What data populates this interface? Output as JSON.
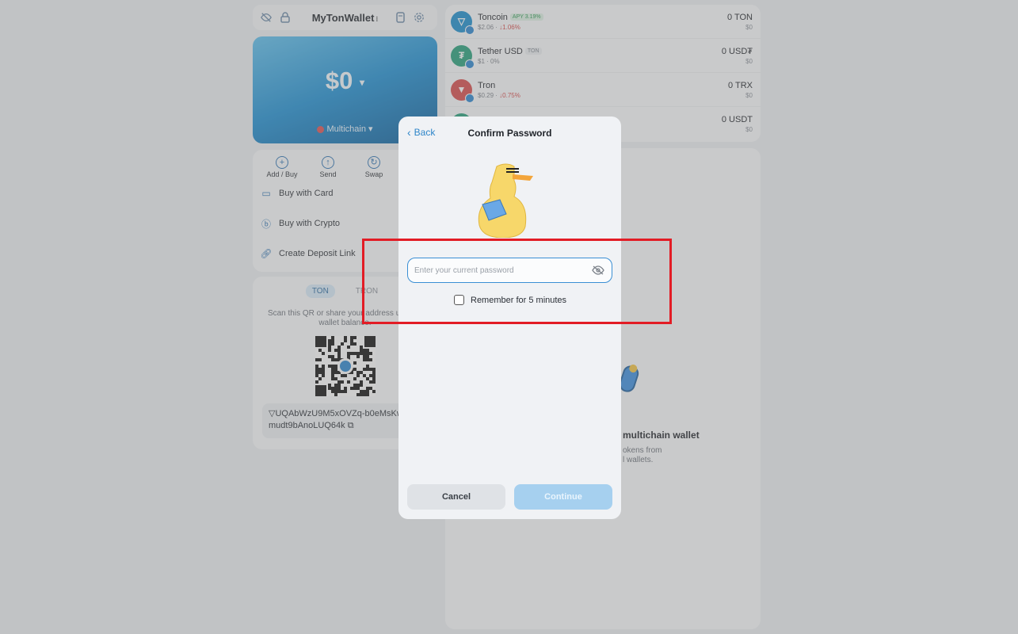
{
  "wallet": {
    "name": "MyTonWallet",
    "balance": "$0",
    "network": "Multichain"
  },
  "actions": [
    {
      "label": "Add / Buy",
      "icon": "plus-circle-icon"
    },
    {
      "label": "Send",
      "icon": "arrow-up-icon"
    },
    {
      "label": "Swap",
      "icon": "swap-icon"
    }
  ],
  "menu": [
    {
      "label": "Buy with Card",
      "icon": "card-icon"
    },
    {
      "label": "Buy with Crypto",
      "icon": "coin-icon"
    },
    {
      "label": "Create Deposit Link",
      "icon": "link-icon"
    }
  ],
  "receive": {
    "tabs": [
      "TON",
      "TRON"
    ],
    "active_tab": "TON",
    "scan_text": "Scan this QR or share your address up your wallet balance.",
    "address": "UQAbWzU9M5xOVZq-b0eMsKwiY-VVmudt9bAnoLUQ64k"
  },
  "tokens": [
    {
      "name": "Toncoin",
      "tag": "APY 3.19%",
      "tag_style": "green",
      "price": "$2.06",
      "change": "↓1.06%",
      "change_neg": true,
      "amount": "0 TON",
      "usd": "$0",
      "color": "#1a8ecf",
      "glyph": "▽"
    },
    {
      "name": "Tether USD",
      "tag": "TON",
      "tag_style": "grey",
      "price": "$1",
      "change": "0%",
      "change_neg": false,
      "amount": "0 USD₮",
      "usd": "$0",
      "color": "#26a17b",
      "glyph": "₮"
    },
    {
      "name": "Tron",
      "tag": "",
      "tag_style": "",
      "price": "$0.29",
      "change": "↓0.75%",
      "change_neg": true,
      "amount": "0 TRX",
      "usd": "$0",
      "color": "#d94b4b",
      "glyph": "▼"
    },
    {
      "name": "",
      "tag": "",
      "tag_style": "",
      "price": "",
      "change": "",
      "change_neg": false,
      "amount": "0 USDT",
      "usd": "$0",
      "color": "#26a17b",
      "glyph": "₮"
    }
  ],
  "multichain": {
    "title": "multichain wallet",
    "desc_line1": "okens from",
    "desc_line2": "l wallets."
  },
  "modal": {
    "back_label": "Back",
    "title": "Confirm Password",
    "password_placeholder": "Enter your current password",
    "remember_label": "Remember for 5 minutes",
    "cancel_label": "Cancel",
    "continue_label": "Continue"
  },
  "colors": {
    "accent": "#2f86c9",
    "highlight": "#e21c25",
    "continue_disabled": "#a6d0ef"
  }
}
